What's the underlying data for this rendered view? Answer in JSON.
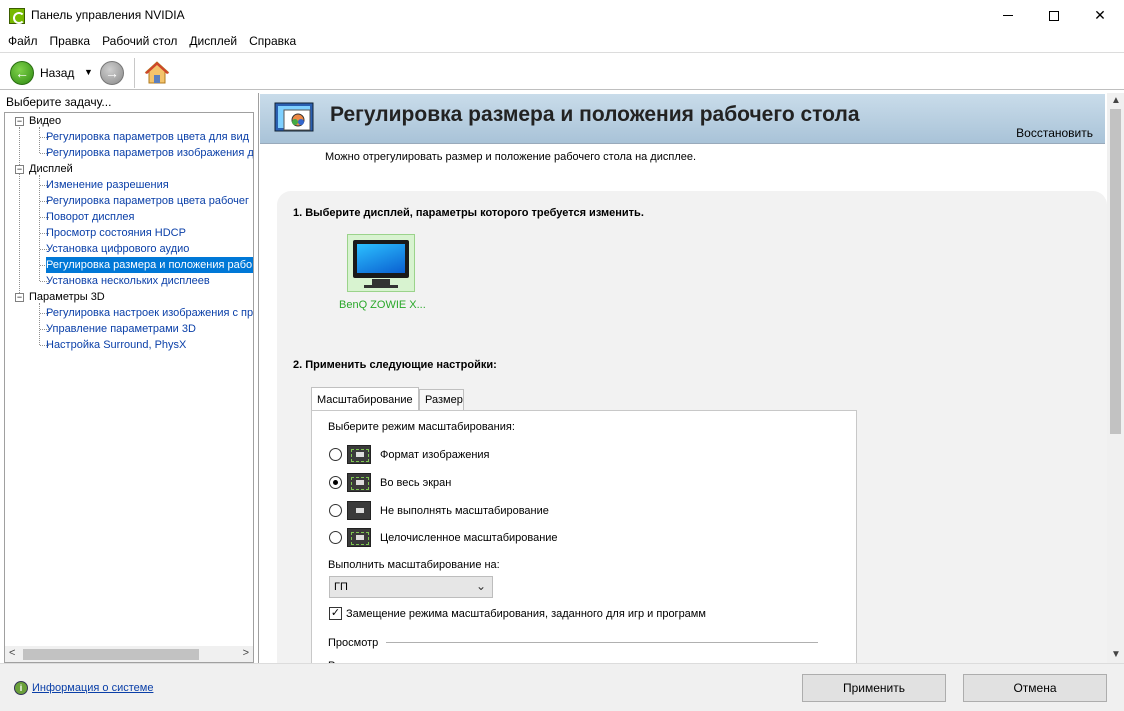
{
  "window": {
    "title": "Панель управления NVIDIA"
  },
  "menu": [
    "Файл",
    "Правка",
    "Рабочий стол",
    "Дисплей",
    "Справка"
  ],
  "toolbar": {
    "back_label": "Назад"
  },
  "sidebar": {
    "caption": "Выберите задачу...",
    "groups": [
      {
        "label": "Видео",
        "items": [
          "Регулировка параметров цвета для вид",
          "Регулировка параметров изображения д"
        ]
      },
      {
        "label": "Дисплей",
        "items": [
          "Изменение разрешения",
          "Регулировка параметров цвета рабочег",
          "Поворот дисплея",
          "Просмотр состояния HDCP",
          "Установка цифрового аудио",
          "Регулировка размера и положения рабо",
          "Установка нескольких дисплеев"
        ]
      },
      {
        "label": "Параметры 3D",
        "items": [
          "Регулировка настроек изображения с пр",
          "Управление параметрами 3D",
          "Настройка Surround, PhysX"
        ]
      }
    ],
    "selected": "Регулировка размера и положения рабо"
  },
  "page": {
    "title": "Регулировка размера и положения рабочего стола",
    "restore": "Восстановить",
    "description": "Можно отрегулировать размер и положение рабочего стола на дисплее.",
    "step1": "1. Выберите дисплей, параметры которого требуется изменить.",
    "display_name": "BenQ ZOWIE X...",
    "step2": "2. Применить следующие настройки:",
    "tabs": [
      "Масштабирование",
      "Размер"
    ],
    "scaling_mode_label": "Выберите режим масштабирования:",
    "scaling_options": [
      "Формат изображения",
      "Во весь экран",
      "Не выполнять масштабирование",
      "Целочисленное масштабирование"
    ],
    "selected_option_index": 1,
    "perform_on_label": "Выполнить масштабирование на:",
    "perform_on_value": "ГП",
    "override_label": "Замещение режима масштабирования, заданного для игр и программ",
    "override_checked": true,
    "preview_label": "Просмотр",
    "cut_label": "Разрешение:"
  },
  "bottom": {
    "info_link": "Информация о системе",
    "apply": "Применить",
    "cancel": "Отмена"
  },
  "colors": {
    "accent": "#0078d7",
    "nvidia_green": "#76b900",
    "link": "#0a3fa8",
    "banner": "#b7cee0"
  }
}
